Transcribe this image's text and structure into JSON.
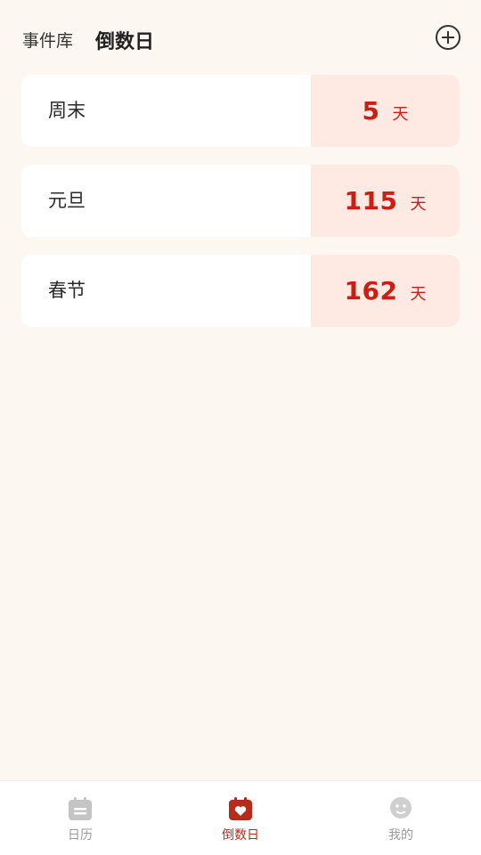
{
  "header": {
    "tab_library": "事件库",
    "tab_countdown": "倒数日"
  },
  "events": [
    {
      "name": "周末",
      "days": "5",
      "unit": "天"
    },
    {
      "name": "元旦",
      "days": "115",
      "unit": "天"
    },
    {
      "name": "春节",
      "days": "162",
      "unit": "天"
    }
  ],
  "bottom_nav": {
    "items": [
      {
        "label": "日历",
        "icon": "calendar-icon",
        "active": false
      },
      {
        "label": "倒数日",
        "icon": "calendar-heart-icon",
        "active": true
      },
      {
        "label": "我的",
        "icon": "profile-icon",
        "active": false
      }
    ]
  },
  "colors": {
    "background": "#fdf7f1",
    "accent_red": "#cc1f13",
    "days_bg": "#fee9e3",
    "nav_active": "#b52d1a",
    "nav_inactive": "#9a9a9a"
  }
}
